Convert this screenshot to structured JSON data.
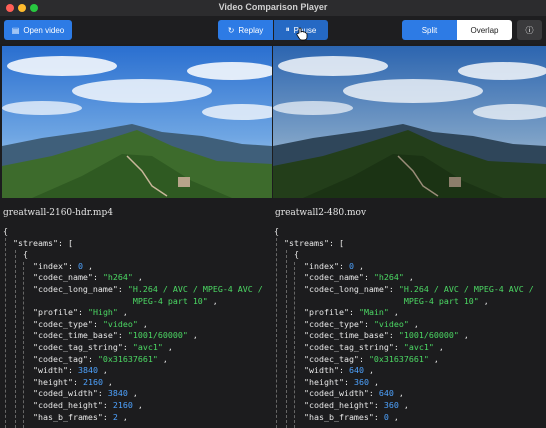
{
  "window": {
    "title": "Video Comparison Player"
  },
  "toolbar": {
    "open_label": "Open video",
    "replay_label": "Replay",
    "pause_label": "Pause",
    "split_label": "Split",
    "overlap_label": "Overlap",
    "info_icon": "info-icon"
  },
  "left": {
    "filename": "greatwall-2160-hdr.mp4",
    "lines": [
      "{",
      "  \"streams\": [",
      "    {",
      "      \"index\": 0 ,",
      "      \"codec_name\": \"h264\" ,",
      "      \"codec_long_name\": \"H.264 / AVC / MPEG-4 AVC /",
      "                          MPEG-4 part 10\" ,",
      "      \"profile\": \"High\" ,",
      "      \"codec_type\": \"video\" ,",
      "      \"codec_time_base\": \"1001/60000\" ,",
      "      \"codec_tag_string\": \"avc1\" ,",
      "      \"codec_tag\": \"0x31637661\" ,",
      "      \"width\": 3840 ,",
      "      \"height\": 2160 ,",
      "      \"coded_width\": 3840 ,",
      "      \"coded_height\": 2160 ,",
      "      \"has_b_frames\": 2 ,"
    ]
  },
  "right": {
    "filename": "greatwall2-480.mov",
    "lines": [
      "{",
      "  \"streams\": [",
      "    {",
      "      \"index\": 0 ,",
      "      \"codec_name\": \"h264\" ,",
      "      \"codec_long_name\": \"H.264 / AVC / MPEG-4 AVC /",
      "                          MPEG-4 part 10\" ,",
      "      \"profile\": \"Main\" ,",
      "      \"codec_type\": \"video\" ,",
      "      \"codec_time_base\": \"1001/60000\" ,",
      "      \"codec_tag_string\": \"avc1\" ,",
      "      \"codec_tag\": \"0x31637661\" ,",
      "      \"width\": 640 ,",
      "      \"height\": 360 ,",
      "      \"coded_width\": 640 ,",
      "      \"coded_height\": 360 ,",
      "      \"has_b_frames\": 0 ,"
    ]
  },
  "colors": {
    "accent": "#2d7be5",
    "string": "#4cd964",
    "number": "#4ea3ff"
  }
}
